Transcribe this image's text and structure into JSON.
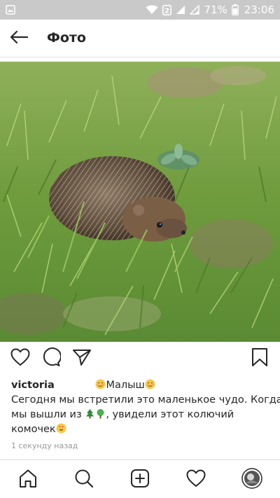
{
  "status_bar": {
    "battery_percent": "71%",
    "time": "23:06",
    "icons": [
      "gallery-icon",
      "wifi-icon",
      "data-saver-icon",
      "signal-icon",
      "signal-icon",
      "battery-icon"
    ]
  },
  "header": {
    "title": "Фото",
    "back_icon": "arrow-left-icon"
  },
  "post": {
    "image": "hedgehog in green grass",
    "actions": [
      "heart-icon",
      "comment-icon",
      "share-icon",
      "bookmark-icon"
    ],
    "caption": {
      "username": "victoria",
      "title_text": "Малыш",
      "line1": "Сегодня мы встретили это маленькое чудо. Когда",
      "line2_start": "мы вышли из ",
      "line2_end": ", увидели этот колючий",
      "line3": "комочек"
    },
    "timestamp": "1 секунду назад"
  },
  "colors": {
    "status_bar": "#c9c9c9",
    "text": "#262626",
    "muted": "#999999",
    "grass": "#6e9b3c"
  },
  "bottom_nav": [
    "home-icon",
    "search-icon",
    "add-post-icon",
    "activity-heart-icon",
    "profile-avatar"
  ]
}
